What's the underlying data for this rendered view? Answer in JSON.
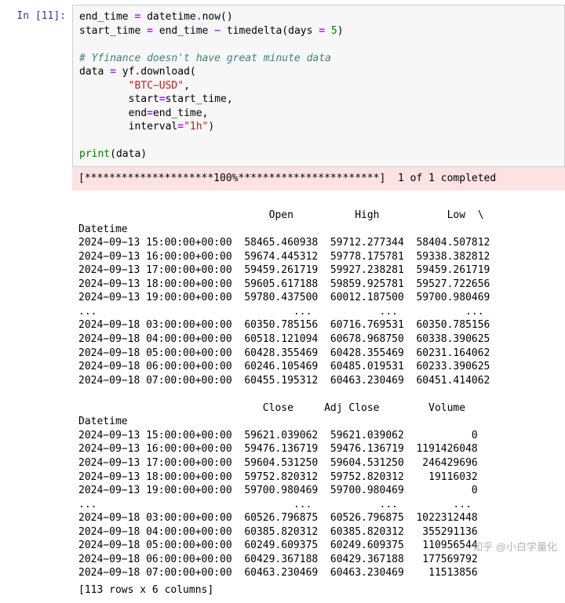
{
  "cell": {
    "prompt_label": "In [11]:",
    "code": {
      "l1_a": "end_time ",
      "l1_eq": "=",
      "l1_b": " datetime",
      "l1_dot": ".",
      "l1_fn": "now",
      "l1_paren": "()",
      "l2_a": "start_time ",
      "l2_eq": "=",
      "l2_b": " end_time ",
      "l2_minus": "−",
      "l2_c": " timedelta(days ",
      "l2_eq2": "=",
      "l2_sp": " ",
      "l2_num": "5",
      "l2_close": ")",
      "l3_blank": "",
      "l4_cmt": "# Yfinance doesn't have great minute data",
      "l5_a": "data ",
      "l5_eq": "=",
      "l5_b": " yf",
      "l5_dot": ".",
      "l5_fn": "download",
      "l5_open": "(",
      "l6_indent": "        ",
      "l6_str": "\"BTC−USD\"",
      "l6_comma": ",",
      "l7_indent": "        ",
      "l7_kw": "start",
      "l7_eq": "=",
      "l7_val": "start_time,",
      "l8_indent": "        ",
      "l8_kw": "end",
      "l8_eq": "=",
      "l8_val": "end_time,",
      "l9_indent": "        ",
      "l9_kw": "interval",
      "l9_eq": "=",
      "l9_str": "\"1h\"",
      "l9_close": ")",
      "l10_blank": "",
      "l11_print": "print",
      "l11_open": "(",
      "l11_arg": "data",
      "l11_close": ")"
    }
  },
  "progress": {
    "text": "[*********************100%***********************]  1 of 1 completed"
  },
  "output": {
    "block1": {
      "header": "                               Open          High           Low  \\",
      "index_h": "Datetime                                                           ",
      "rows": [
        "2024−09−13 15:00:00+00:00  58465.460938  59712.277344  58404.507812",
        "2024−09−13 16:00:00+00:00  59674.445312  59778.175781  59338.382812",
        "2024−09−13 17:00:00+00:00  59459.261719  59927.238281  59459.261719",
        "2024−09−13 18:00:00+00:00  59605.617188  59859.925781  59527.722656",
        "2024−09−13 19:00:00+00:00  59780.437500  60012.187500  59700.980469",
        "...                                ...           ...           ...",
        "2024−09−18 03:00:00+00:00  60350.785156  60716.769531  60350.785156",
        "2024−09−18 04:00:00+00:00  60518.121094  60678.968750  60338.390625",
        "2024−09−18 05:00:00+00:00  60428.355469  60428.355469  60231.164062",
        "2024−09−18 06:00:00+00:00  60246.105469  60485.019531  60233.390625",
        "2024−09−18 07:00:00+00:00  60455.195312  60463.230469  60451.414062"
      ]
    },
    "block2": {
      "header": "                              Close     Adj Close        Volume",
      "index_h": "Datetime                                                       ",
      "rows": [
        "2024−09−13 15:00:00+00:00  59621.039062  59621.039062           0",
        "2024−09−13 16:00:00+00:00  59476.136719  59476.136719  1191426048",
        "2024−09−13 17:00:00+00:00  59604.531250  59604.531250   246429696",
        "2024−09−13 18:00:00+00:00  59752.820312  59752.820312    19116032",
        "2024−09−13 19:00:00+00:00  59700.980469  59700.980469           0",
        "...                                ...           ...         ...",
        "2024−09−18 03:00:00+00:00  60526.796875  60526.796875  1022312448",
        "2024−09−18 04:00:00+00:00  60385.820312  60385.820312   355291136",
        "2024−09−18 05:00:00+00:00  60249.609375  60249.609375   110956544",
        "2024−09−18 06:00:00+00:00  60429.367188  60429.367188   177569792",
        "2024−09−18 07:00:00+00:00  60463.230469  60463.230469    11513856"
      ]
    },
    "shape": "[113 rows x 6 columns]"
  },
  "watermark": "知乎 @小白学量化"
}
